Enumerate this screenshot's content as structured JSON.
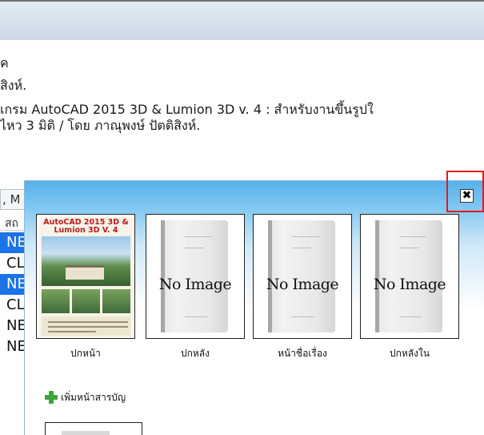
{
  "background": {
    "lines": [
      "ค",
      "สิงห์.",
      "เกรม AutoCAD 2015 3D & Lumion 3D v. 4 :  สำหรับงานขึ้นรูปใ",
      "ไหว 3 มิติ /  โดย ภาณุพงษ์ ปัตติสิงห์."
    ],
    "tab_label": ", M",
    "column_header": "สถ",
    "rows": [
      "NE",
      "CL",
      "NE",
      "CL",
      "NE",
      "NE"
    ]
  },
  "dialog": {
    "close_label": "✖",
    "cover_title": "AutoCAD 2015 3D & Lumion 3D V. 4",
    "thumbnails": [
      {
        "label": "ปกหน้า",
        "image": "cover"
      },
      {
        "label": "ปกหลัง",
        "image": "No Image"
      },
      {
        "label": "หน้าชื่อเรื่อง",
        "image": "No Image"
      },
      {
        "label": "ปกหลังใน",
        "image": "No Image"
      }
    ],
    "add_toc_label": "เพิ่มหน้าสารบัญ",
    "add_icon": "plus-icon"
  },
  "colors": {
    "selected_row": "#1a73e8",
    "highlight_border": "#e21b1b",
    "add_icon": "#3da33d"
  }
}
